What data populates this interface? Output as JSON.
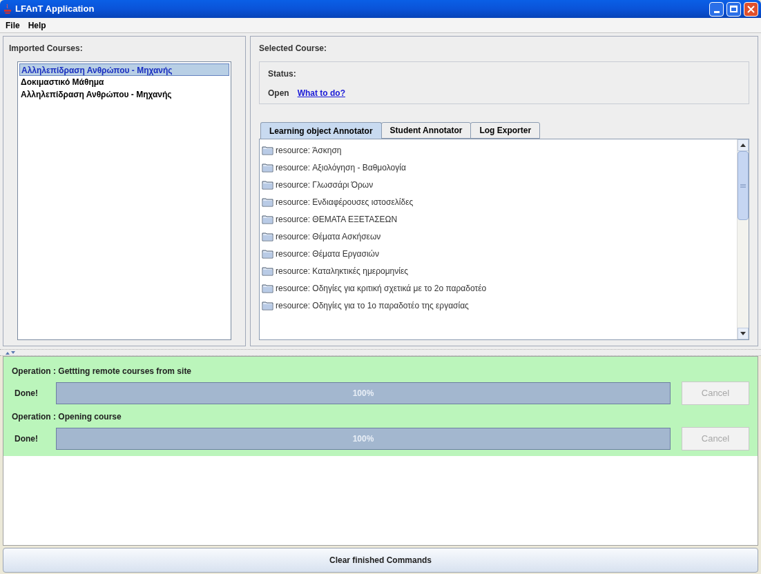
{
  "window": {
    "title": "LFAnT Application"
  },
  "menu": [
    "File",
    "Help"
  ],
  "imported_courses": {
    "title": "Imported Courses:",
    "items": [
      {
        "label": "Αλληλεπίδραση Ανθρώπου - Μηχανής",
        "selected": true
      },
      {
        "label": "Δοκιμαστικό Μάθημα",
        "selected": false
      },
      {
        "label": "Αλληλεπίδραση Ανθρώπου - Μηχανής",
        "selected": false
      }
    ]
  },
  "selected_course": {
    "title": "Selected Course:",
    "status_label": "Status:",
    "status": "Open",
    "help_link": "What to do?"
  },
  "tabs": [
    {
      "label": "Learning object Annotator",
      "selected": true
    },
    {
      "label": "Student Annotator",
      "selected": false
    },
    {
      "label": "Log Exporter",
      "selected": false
    }
  ],
  "resources": [
    "resource: Άσκηση",
    "resource: Αξιολόγηση - Βαθμολογία",
    "resource: Γλωσσάρι Όρων",
    "resource: Ενδιαφέρουσες ιστοσελίδες",
    "resource: ΘΕΜΑΤΑ ΕΞΕΤΑΣΕΩΝ",
    "resource: Θέματα Ασκήσεων",
    "resource: Θέματα Εργασιών",
    "resource: Καταληκτικές ημερομηνίες",
    "resource: Οδηγίες για κριτική σχετικά με το 2ο παραδοτέο",
    "resource: Οδηγίες για το 1ο παραδοτέο της εργασίας"
  ],
  "operations": [
    {
      "title": "Operation : Gettting remote courses from site",
      "status": "Done!",
      "level": 1,
      "reading": "100%",
      "cancel": {
        "label": "Cancel",
        "disabled": true
      }
    },
    {
      "title": "Operation : Opening course",
      "status": "Done!",
      "level": 1,
      "reading": "100%",
      "cancel": {
        "label": "Cancel",
        "disabled": true
      }
    }
  ],
  "clear_button": "Clear finished Commands"
}
